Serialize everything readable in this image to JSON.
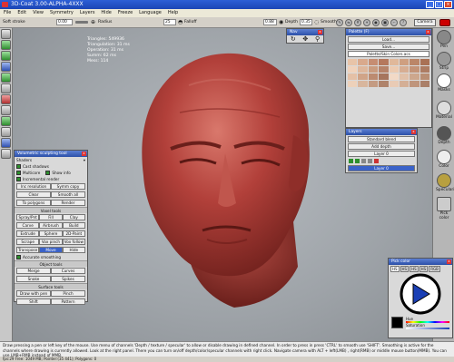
{
  "window": {
    "title": "3D-Coat 3.00-ALPHA-4XXX",
    "icon": "3dcoat-app-icon"
  },
  "window_buttons": [
    "_",
    "□",
    "×"
  ],
  "menu": [
    "File",
    "Edit",
    "View",
    "Symmetry",
    "Layers",
    "Hide",
    "Freeze",
    "Language",
    "Help"
  ],
  "toolbar": {
    "brush_label": "Soft stroke",
    "brush_value": "0.00",
    "radius_label": "Radius",
    "radius_value": "25",
    "falloff_label": "Falloff",
    "depth_value": "0.88",
    "depth_label": "Depth",
    "smooth_value": "0.35",
    "smooth_label": "Smoothing",
    "camera_label": "Camera"
  },
  "stats": [
    "Triangles: 549936",
    "Triangulation: 31 ms",
    "Operation: 31 ms",
    "Summ: 62 ms",
    "Mess: 114"
  ],
  "nav_panel": {
    "title": "Nav",
    "icons": [
      "rotate-icon",
      "move-icon",
      "zoom-icon"
    ]
  },
  "palette_panel": {
    "title": "Palette (F)",
    "buttons": [
      "Load...",
      "Save..."
    ],
    "selected": "Palette/Skin Colors.acs",
    "swatches": [
      "#e8c4a8",
      "#d9a98c",
      "#c68d72",
      "#b5785d",
      "#e0b89a",
      "#cf9f80",
      "#bb8668",
      "#a97155",
      "#f0d2bb",
      "#deb79c",
      "#ca9c7f",
      "#b6836a",
      "#eccab0",
      "#d7ad92",
      "#c39377",
      "#ad7c63",
      "#e4c0a6",
      "#d0a488",
      "#bc8b70",
      "#a6755d",
      "#f2d9c6",
      "#e1c0a8",
      "#cda78d",
      "#b98e74",
      "#edd1ba",
      "#d8b69d",
      "#c49b82",
      "#af836b",
      "#e9cbb5",
      "#d4af96",
      "#bf957c",
      "#aa7f68"
    ]
  },
  "layers_panel": {
    "title": "Layers",
    "blend": "Standard blend",
    "add_depth": "Add depth",
    "layer_index": "Layer 0",
    "current_layer": "Layer 0"
  },
  "sculpt_panel": {
    "title": "Volumetric sculpting tool",
    "shaders": "Shaders",
    "cast_shadows": "Cast shadows",
    "multicore": "Multicore",
    "show_info": "Show info",
    "incremental": "Incremental render",
    "btn_inc_res": "Inc resolution",
    "btn_symm_copy": "Symm copy",
    "btn_clear": "Clear",
    "btn_smooth_all": "Smooth all",
    "btn_to_polygons": "To polygons",
    "btn_render": "Render",
    "voxel_header": "Voxel tools",
    "voxel_tools": [
      [
        "Spray/Pnt",
        "Fill",
        "Clay"
      ],
      [
        "Carve",
        "Airbrush",
        "Build"
      ],
      [
        "Extrude",
        "Sphere",
        "2D-Paint"
      ],
      [
        "Scrape",
        "Vox pinch",
        "Vox follow"
      ],
      [
        "Transpose",
        "Move",
        "Hide"
      ]
    ],
    "accurate": "Accurate smoothing",
    "object_header": "Object tools",
    "object_tools": [
      [
        "Merge",
        "Curves"
      ],
      [
        "Snake",
        "Spikes"
      ]
    ],
    "surface_header": "Surface tools",
    "surface_tools": [
      [
        "Draw with pen",
        "Pinch"
      ],
      [
        "Shift",
        "Pattern"
      ]
    ]
  },
  "right_toolbar": [
    "Pen",
    "Strip",
    "Masks",
    "Material",
    "Depth",
    "Color",
    "Specularity",
    "Pick color"
  ],
  "pick_color_panel": {
    "title": "Pick color",
    "tabs": [
      "HS",
      "HS",
      "HS",
      "HS",
      "RGB"
    ],
    "hue_label": "Hue",
    "sat_label": "Saturation"
  },
  "help_text": "Draw pressing a pen or left key of the mouse. Use menu of channels 'Depth / texture / specular' to allow or disable drawing in defined channel. In order to press in press 'CTRL' to smooth use 'SHIFT'. Smoothing is active for the channels where drawing is currently allowed. Look at the right panel. There you can turn on/off depth/color/specular channels with right click. Navigate camera with ALT + left(LMB) , right(RMB) or middle mouse button(MMB). You can use LMB+RMB instead of MMB.",
  "status_bar": "fps:29   Free: 1049 MB; Pointer:(35 441); Polygons: 0",
  "colors": {
    "head_base": "#b2403a",
    "head_shadow": "#7a2420",
    "head_highlight": "#d9786c",
    "title_blue": "#2d5fd6"
  }
}
